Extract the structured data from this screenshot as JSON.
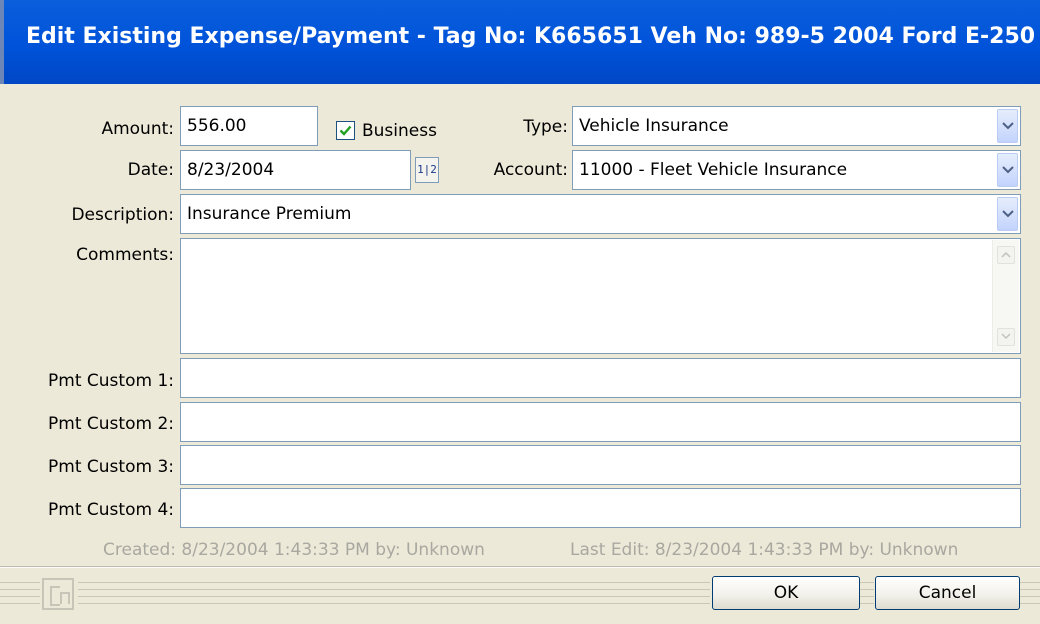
{
  "window": {
    "title": "Edit Existing Expense/Payment - Tag No: K665651 Veh No: 989-5 2004 Ford E-250"
  },
  "form": {
    "amount": {
      "label": "Amount:",
      "value": "556.00"
    },
    "business": {
      "label": "Business",
      "checked": true
    },
    "type": {
      "label": "Type:",
      "value": "Vehicle Insurance"
    },
    "date": {
      "label": "Date:",
      "value": "8/23/2004"
    },
    "calendar_glyph": "1|2",
    "account": {
      "label": "Account:",
      "value": "11000 - Fleet Vehicle Insurance"
    },
    "description": {
      "label": "Description:",
      "value": "Insurance Premium"
    },
    "comments": {
      "label": "Comments:",
      "value": ""
    },
    "custom": [
      {
        "label": "Pmt Custom 1:",
        "value": ""
      },
      {
        "label": "Pmt Custom 2:",
        "value": ""
      },
      {
        "label": "Pmt Custom 3:",
        "value": ""
      },
      {
        "label": "Pmt Custom 4:",
        "value": ""
      }
    ]
  },
  "footer": {
    "created": "Created: 8/23/2004 1:43:33 PM by: Unknown",
    "last_edit": "Last Edit: 8/23/2004 1:43:33 PM by: Unknown"
  },
  "buttons": {
    "ok": "OK",
    "cancel": "Cancel"
  },
  "colors": {
    "title_bar": "#0054e3",
    "dialog_bg": "#ece9d8",
    "field_border": "#7f9db9"
  }
}
